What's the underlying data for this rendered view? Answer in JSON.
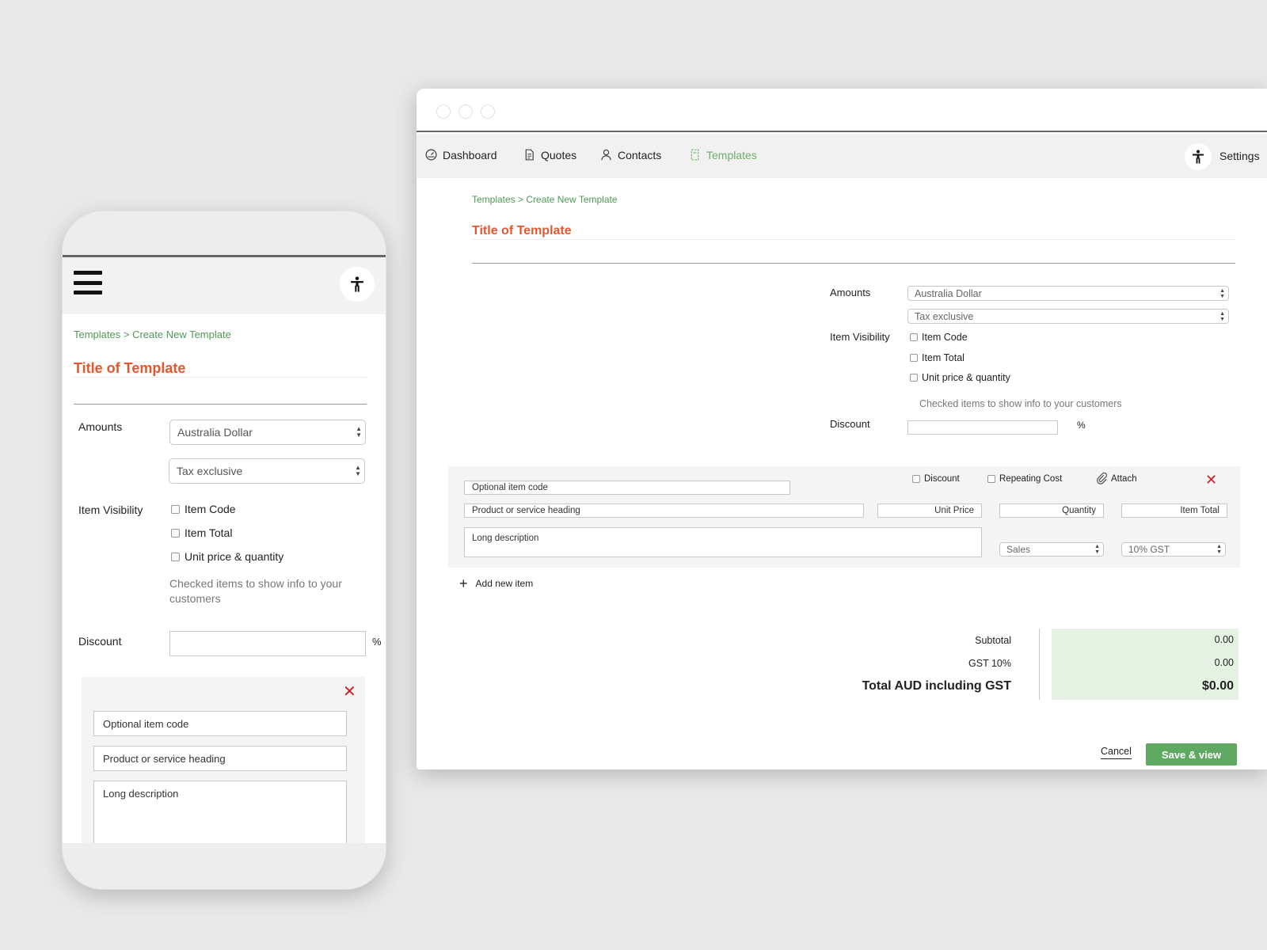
{
  "desktop": {
    "nav": {
      "dashboard": "Dashboard",
      "quotes": "Quotes",
      "contacts": "Contacts",
      "templates": "Templates",
      "settings": "Settings"
    },
    "breadcrumb": "Templates > Create New Template",
    "title": "Title of Template",
    "amounts_label": "Amounts",
    "currency": "Australia Dollar",
    "tax_mode": "Tax exclusive",
    "item_visibility_label": "Item Visibility",
    "visibility_options": [
      "Item Code",
      "Item Total",
      "Unit price & quantity"
    ],
    "visibility_hint": "Checked items to show info to your customers",
    "discount_label": "Discount",
    "percent": "%",
    "item": {
      "opt_discount": "Discount",
      "opt_repeating": "Repeating Cost",
      "attach": "Attach",
      "code_placeholder": "Optional item code",
      "heading_placeholder": "Product or service heading",
      "unit_price_placeholder": "Unit Price",
      "quantity_placeholder": "Quantity",
      "item_total_placeholder": "Item Total",
      "description_placeholder": "Long description",
      "account": "Sales",
      "tax_rate": "10% GST"
    },
    "add_new_item": "Add new item",
    "totals": {
      "subtotal_label": "Subtotal",
      "subtotal_value": "0.00",
      "gst_label": "GST 10%",
      "gst_value": "0.00",
      "total_label": "Total AUD including GST",
      "total_value": "$0.00"
    },
    "cancel": "Cancel",
    "save": "Save & view"
  },
  "mobile": {
    "breadcrumb": "Templates > Create New Template",
    "title": "Title of Template",
    "amounts_label": "Amounts",
    "currency": "Australia Dollar",
    "tax_mode": "Tax exclusive",
    "item_visibility_label": "Item Visibility",
    "visibility_options": [
      "Item Code",
      "Item Total",
      "Unit price & quantity"
    ],
    "visibility_hint": "Checked items to show info to your customers",
    "discount_label": "Discount",
    "percent": "%",
    "code_placeholder": "Optional item code",
    "heading_placeholder": "Product or service heading",
    "description_placeholder": "Long description"
  },
  "colors": {
    "accent_green": "#5fa963",
    "title_orange": "#e4572e",
    "close_red": "#cc1f1f",
    "totals_bg": "#e5f2e3"
  }
}
